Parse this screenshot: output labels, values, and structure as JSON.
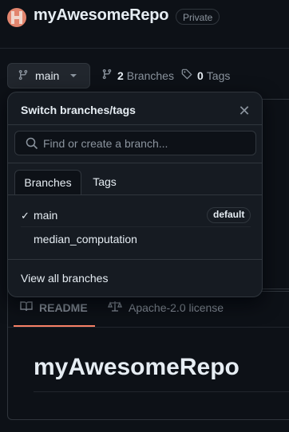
{
  "repo": {
    "name": "myAwesomeRepo",
    "visibility": "Private",
    "avatar_icon": "identicon-avatar"
  },
  "branch_bar": {
    "current_branch": "main",
    "branches_count": "2",
    "branches_label": "Branches",
    "tags_count": "0",
    "tags_label": "Tags"
  },
  "popup": {
    "title": "Switch branches/tags",
    "close_icon": "close-icon",
    "search_placeholder": "Find or create a branch...",
    "tabs": [
      {
        "label": "Branches",
        "selected": true
      },
      {
        "label": "Tags",
        "selected": false
      }
    ],
    "branches": [
      {
        "name": "main",
        "checked": true,
        "badge": "default"
      },
      {
        "name": "median_computation",
        "checked": false,
        "badge": ""
      }
    ],
    "view_all": "View all branches"
  },
  "readme": {
    "tab_readme": "README",
    "tab_license": "Apache-2.0 license",
    "heading": "myAwesomeRepo"
  },
  "colors": {
    "background": "#0d1117",
    "popup_bg": "#161b22",
    "border": "#30363d",
    "text": "#e6edf3",
    "muted": "#8b949e",
    "accent_underline": "#f78166"
  }
}
